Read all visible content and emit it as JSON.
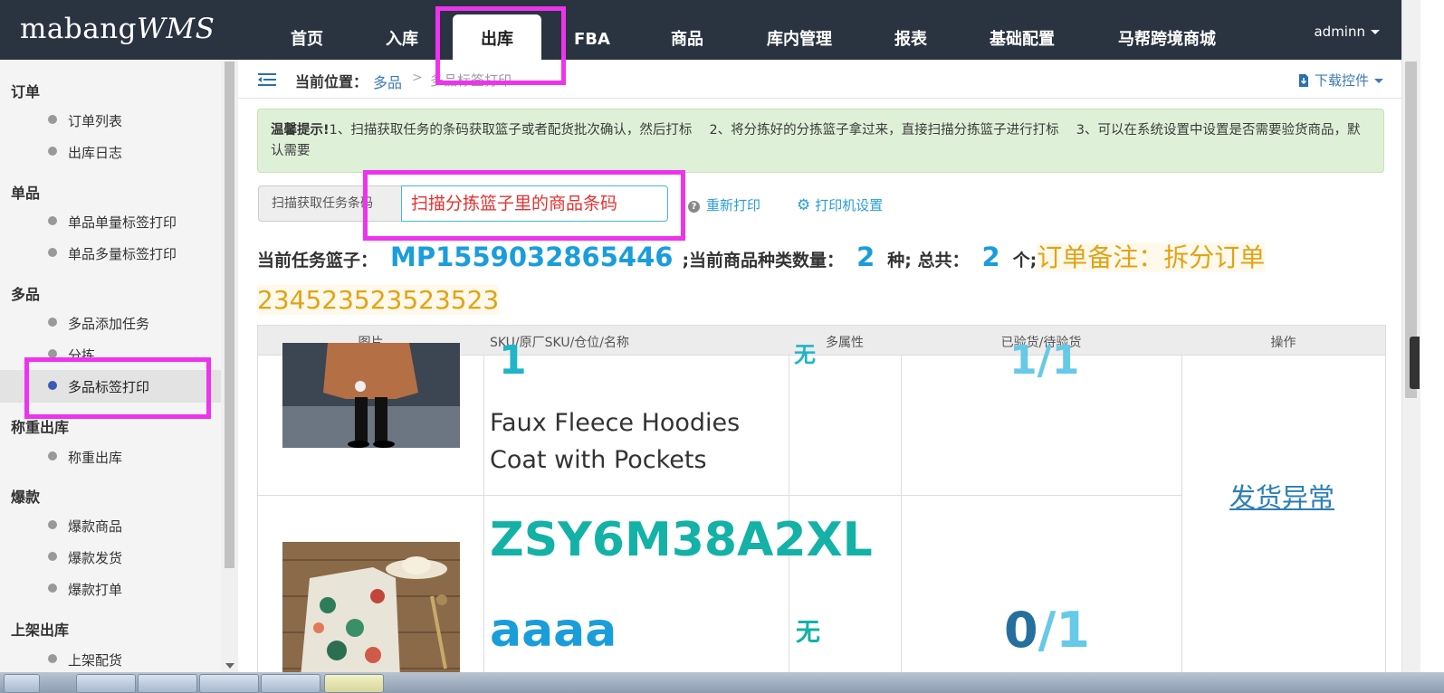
{
  "header": {
    "logo_main": "mabang",
    "logo_suffix": "WMS",
    "nav": [
      {
        "label": "首页",
        "active": false
      },
      {
        "label": "入库",
        "active": false
      },
      {
        "label": "出库",
        "active": true
      },
      {
        "label": "FBA",
        "active": false
      },
      {
        "label": "商品",
        "active": false
      },
      {
        "label": "库内管理",
        "active": false
      },
      {
        "label": "报表",
        "active": false
      },
      {
        "label": "基础配置",
        "active": false
      },
      {
        "label": "马帮跨境商城",
        "active": false
      }
    ],
    "user": "adminn"
  },
  "sidebar": {
    "groups": [
      {
        "title": "订单",
        "items": [
          "订单列表",
          "出库日志"
        ]
      },
      {
        "title": "单品",
        "items": [
          "单品单量标签打印",
          "单品多量标签打印"
        ]
      },
      {
        "title": "多品",
        "items": [
          "多品添加任务",
          "分拣",
          "多品标签打印"
        ]
      },
      {
        "title": "称重出库",
        "items": [
          "称重出库"
        ]
      },
      {
        "title": "爆款",
        "items": [
          "爆款商品",
          "爆款发货",
          "爆款打单"
        ]
      },
      {
        "title": "上架出库",
        "items": [
          "上架配货"
        ]
      }
    ],
    "active_item": "多品标签打印"
  },
  "breadcrumb": {
    "label": "当前位置：",
    "level1": "多品",
    "separator": ">",
    "level2": "多品标签打印"
  },
  "download_label": "下载控件",
  "tip": {
    "title": "温馨提示!",
    "text": "1、扫描获取任务的条码获取篮子或者配货批次确认，然后打标　 2、将分拣好的分拣篮子拿过来，直接扫描分拣篮子进行打标　 3、可以在系统设置中设置是否需要验货商品，默认需要"
  },
  "scan": {
    "addon_label": "扫描获取任务条码",
    "placeholder": "扫描分拣篮子里的商品条码",
    "reprint_label": "重新打印",
    "printer_label": "打印机设置"
  },
  "task_info": {
    "basket_label": "当前任务篮子：",
    "basket_code": "MP1559032865446",
    "kinds_label": ";当前商品种类数量：",
    "kinds_count": "2",
    "kinds_unit": "种; 总共：",
    "total_count": "2",
    "total_unit": "个;",
    "remark": "订单备注：拆分订单234523523523523"
  },
  "table": {
    "headers": [
      "图片",
      "SKU/原厂SKU/仓位/名称",
      "多属性",
      "已验货/待验货",
      "操作"
    ],
    "rows": [
      {
        "sku_fragment": "1",
        "name": "Faux Fleece Hoodies Coat with Pockets",
        "attr": "无",
        "checked": "1",
        "pending": "1"
      },
      {
        "sku": "ZSY6M38A2XL",
        "name": "aaaa",
        "attr": "无",
        "checked": "0",
        "pending": "1"
      }
    ],
    "action_label": "发货异常"
  },
  "colors": {
    "topbar": "#2a3340",
    "highlight": "#ee33ee",
    "link_blue": "#2a9fd6",
    "orange": "#e3a216",
    "teal": "#14b1a7"
  }
}
